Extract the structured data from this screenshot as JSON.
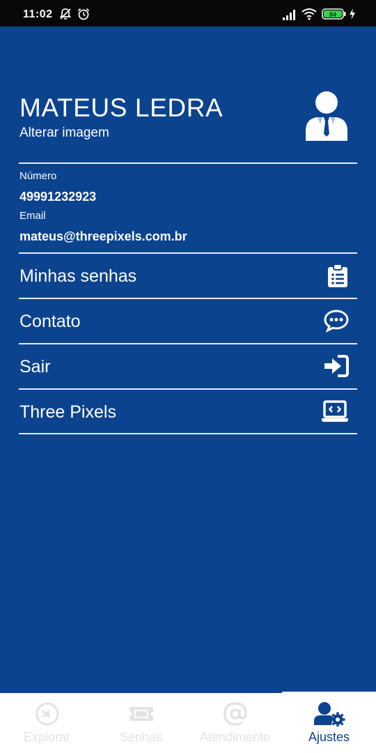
{
  "status_bar": {
    "time": "11:02",
    "battery": "84"
  },
  "profile": {
    "name": "MATEUS LEDRA",
    "change_image": "Alterar imagem",
    "avatar_icon": "user-tie-icon"
  },
  "info": {
    "number_label": "Número",
    "number_value": "49991232923",
    "email_label": "Email",
    "email_value": "mateus@threepixels.com.br"
  },
  "menu": [
    {
      "label": "Minhas senhas",
      "icon": "clipboard-list-icon"
    },
    {
      "label": "Contato",
      "icon": "comment-dots-icon"
    },
    {
      "label": "Sair",
      "icon": "sign-in-icon"
    },
    {
      "label": "Three Pixels",
      "icon": "laptop-code-icon"
    }
  ],
  "tabs": [
    {
      "label": "Explorar",
      "icon": "satellite-icon",
      "active": false
    },
    {
      "label": "Senhas",
      "icon": "ticket-icon",
      "active": false
    },
    {
      "label": "Atendimento",
      "icon": "at-icon",
      "active": false
    },
    {
      "label": "Ajustes",
      "icon": "user-cog-icon",
      "active": true
    }
  ],
  "colors": {
    "primary": "#0c438f",
    "inactive_tab": "#e3e3e3",
    "status_bar": "#080808",
    "battery_fill": "#38d34a"
  }
}
